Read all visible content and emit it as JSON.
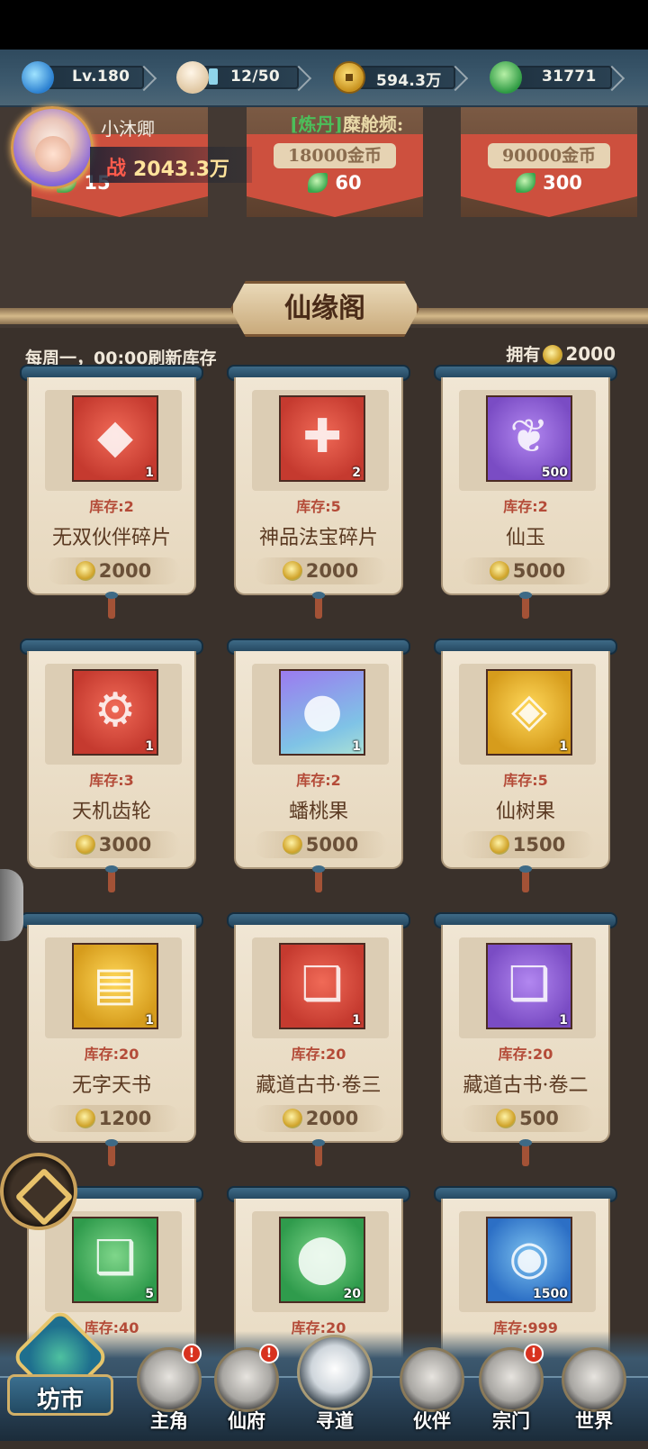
{
  "resources": {
    "level": "Lv.180",
    "stamina": "12/50",
    "gold": "594.3万",
    "jade_leaf": "31771"
  },
  "player": {
    "name": "小沐卿",
    "power_label": "战",
    "power_value": "2043.3万"
  },
  "top_shop": {
    "marquee_tag": "[炼丹]",
    "marquee_text": "糜舱频:",
    "cards": [
      {
        "price": "18000金币",
        "cost": "60"
      },
      {
        "price": "90000金币",
        "cost": "300"
      }
    ],
    "partial_cost": "15"
  },
  "shop": {
    "title": "仙缘阁",
    "refresh_note": "每周一，00:00刷新库存",
    "owned_label": "拥有",
    "owned_amount": "2000",
    "items": [
      {
        "name": "无双伙伴碎片",
        "stock": "库存:2",
        "count": "1",
        "price": "2000",
        "color": "red",
        "icon": "puzzle-piece-icon"
      },
      {
        "name": "神品法宝碎片",
        "stock": "库存:5",
        "count": "2",
        "price": "2000",
        "color": "red",
        "icon": "puzzle-pieces-icon"
      },
      {
        "name": "仙玉",
        "stock": "库存:2",
        "count": "500",
        "price": "5000",
        "color": "purple",
        "icon": "jade-leaf-icon"
      },
      {
        "name": "天机齿轮",
        "stock": "库存:3",
        "count": "1",
        "price": "3000",
        "color": "red",
        "icon": "gear-icon"
      },
      {
        "name": "蟠桃果",
        "stock": "库存:2",
        "count": "1",
        "price": "5000",
        "color": "peach",
        "icon": "peach-icon"
      },
      {
        "name": "仙树果",
        "stock": "库存:5",
        "count": "1",
        "price": "1500",
        "color": "gold",
        "icon": "fruit-icon"
      },
      {
        "name": "无字天书",
        "stock": "库存:20",
        "count": "1",
        "price": "1200",
        "color": "gold",
        "icon": "book-icon"
      },
      {
        "name": "藏道古书·卷三",
        "stock": "库存:20",
        "count": "1",
        "price": "2000",
        "color": "red",
        "icon": "open-book-icon"
      },
      {
        "name": "藏道古书·卷二",
        "stock": "库存:20",
        "count": "1",
        "price": "500",
        "color": "purple",
        "icon": "open-book-icon"
      },
      {
        "name": "",
        "stock": "库存:40",
        "count": "5",
        "price": "",
        "color": "green",
        "icon": "open-book-icon"
      },
      {
        "name": "",
        "stock": "库存:20",
        "count": "20",
        "price": "",
        "color": "green",
        "icon": "stone-icon"
      },
      {
        "name": "",
        "stock": "库存:999",
        "count": "1500",
        "price": "",
        "color": "blue",
        "icon": "coin-icon"
      }
    ]
  },
  "nav": {
    "market": "坊市",
    "items": [
      "主角",
      "仙府",
      "寻道",
      "伙伴",
      "宗门",
      "世界"
    ],
    "badge": "!"
  }
}
